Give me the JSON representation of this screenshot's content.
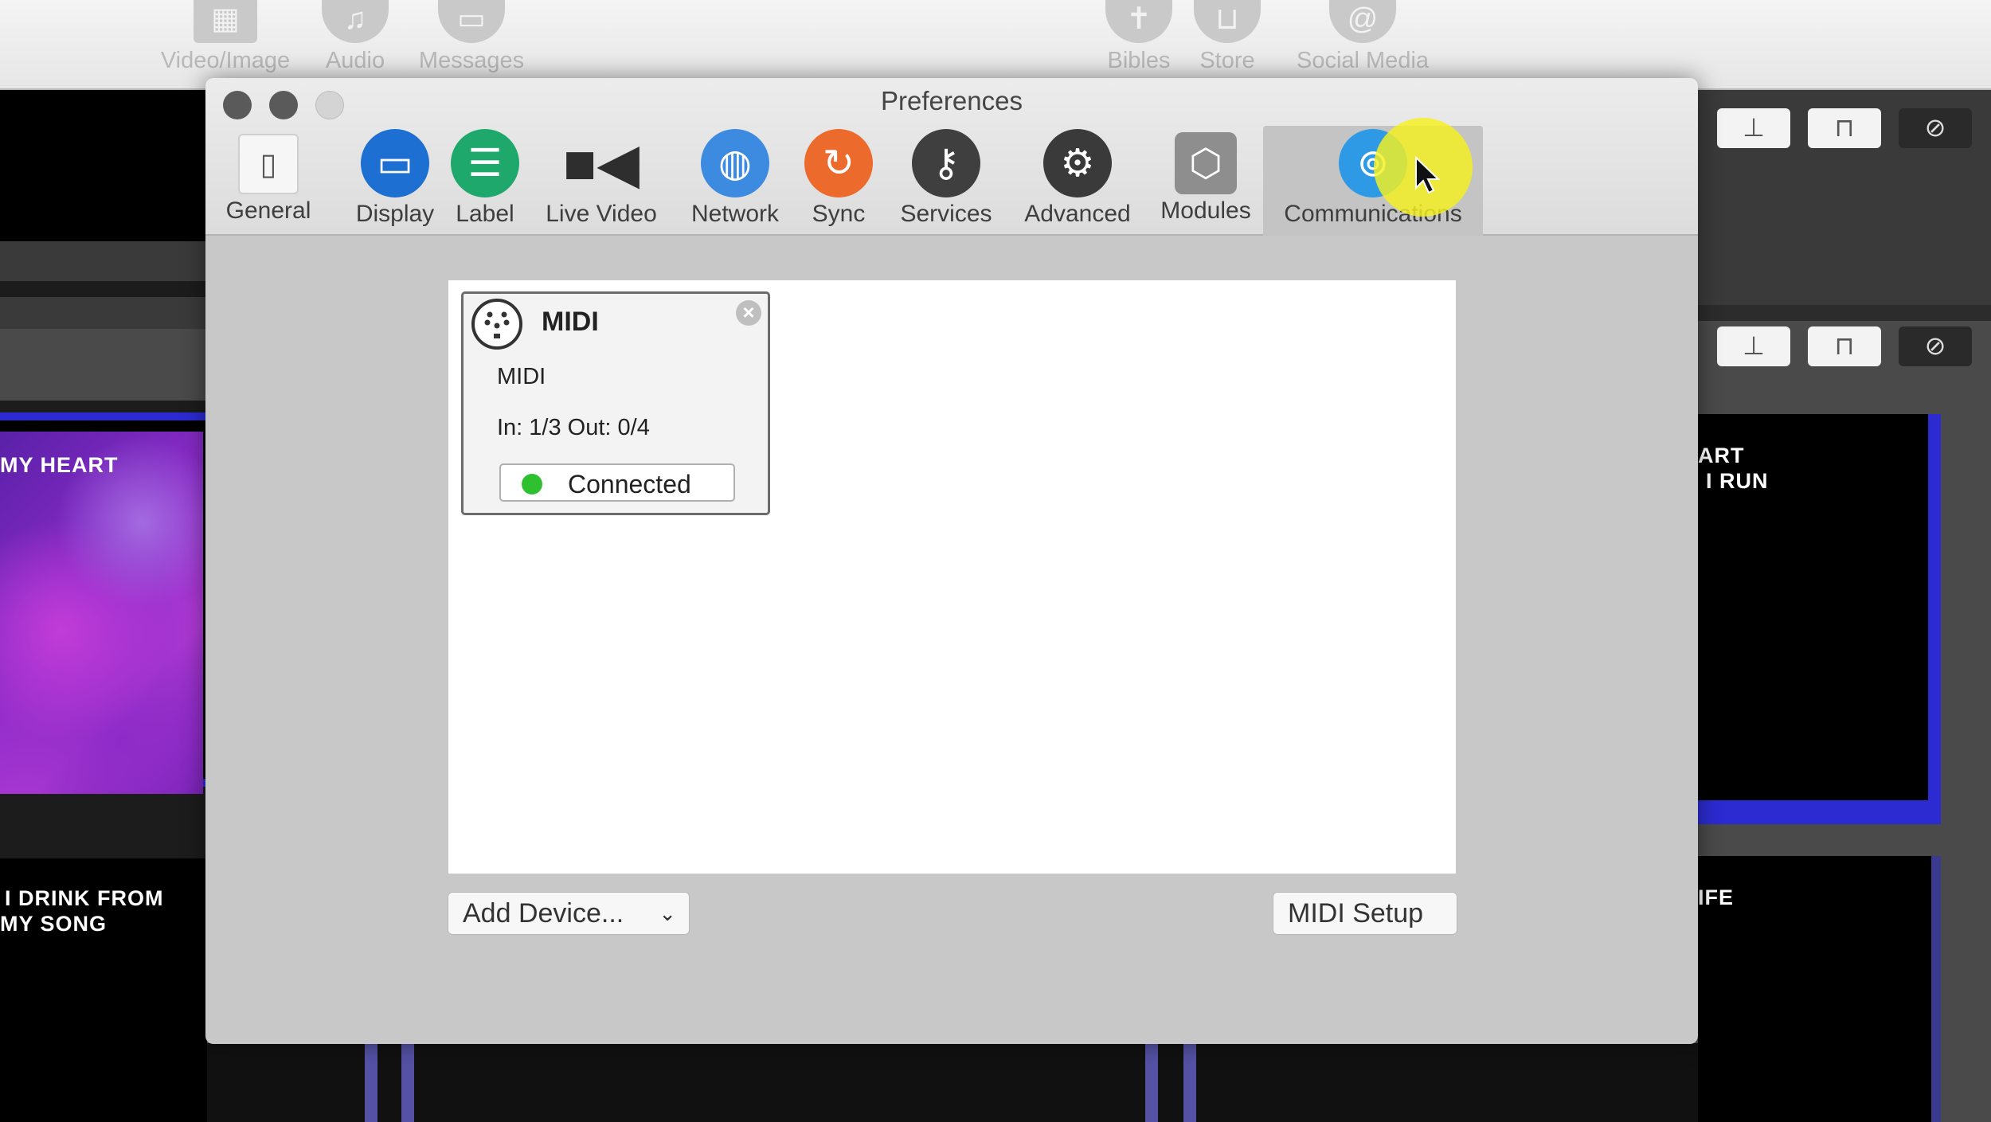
{
  "app_toolbar": {
    "items": [
      {
        "label": "Video/Image",
        "icon": "film-icon"
      },
      {
        "label": "Audio",
        "icon": "music-note-icon"
      },
      {
        "label": "Messages",
        "icon": "messages-icon"
      },
      {
        "label": "Bibles",
        "icon": "bible-icon"
      },
      {
        "label": "Store",
        "icon": "cart-icon"
      },
      {
        "label": "Social Media",
        "icon": "at-sign-icon"
      }
    ]
  },
  "background_slides": {
    "left_1_text": "MY HEART",
    "left_2_text_line1": "I DRINK FROM",
    "left_2_text_line2": "MY SONG",
    "right_1_text_line1": "ART",
    "right_1_text_line2": "I RUN",
    "right_2_text": "IFE"
  },
  "preferences": {
    "title": "Preferences",
    "tabs": [
      {
        "label": "General",
        "icon": "switch-icon",
        "color": "#f0f0f0"
      },
      {
        "label": "Display",
        "icon": "monitor-icon",
        "color": "#1e6fd2"
      },
      {
        "label": "Label",
        "icon": "list-icon",
        "color": "#1fa86c"
      },
      {
        "label": "Live Video",
        "icon": "video-camera-icon",
        "color": "#3a3a3a"
      },
      {
        "label": "Network",
        "icon": "globe-icon",
        "color": "#3d8be0"
      },
      {
        "label": "Sync",
        "icon": "sync-icon",
        "color": "#ec6a2c"
      },
      {
        "label": "Services",
        "icon": "key-icon",
        "color": "#3f3f3f"
      },
      {
        "label": "Advanced",
        "icon": "gear-icon",
        "color": "#3a3a3a"
      },
      {
        "label": "Modules",
        "icon": "box-icon",
        "color": "#8e8e8e"
      },
      {
        "label": "Communications",
        "icon": "broadcast-icon",
        "color": "#2e9ae6"
      }
    ],
    "active_tab": "Communications",
    "device": {
      "title": "MIDI",
      "name": "MIDI",
      "io": "In: 1/3 Out: 0/4",
      "status": "Connected",
      "status_color": "#2fc02f"
    },
    "add_device_label": "Add Device...",
    "midi_setup_label": "MIDI Setup"
  }
}
